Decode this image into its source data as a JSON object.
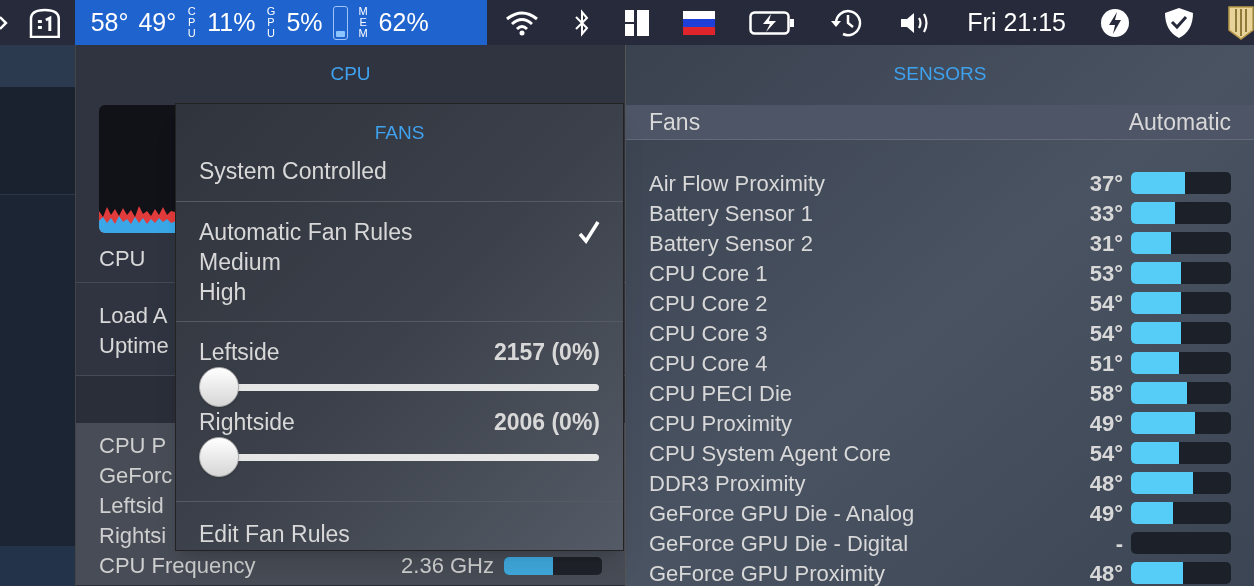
{
  "menu_bar": {
    "stats": [
      {
        "kind": "text",
        "text": "58°"
      },
      {
        "kind": "text",
        "text": "49°"
      },
      {
        "kind": "vlabel",
        "text": "CPU"
      },
      {
        "kind": "text",
        "text": "11%"
      },
      {
        "kind": "vlabel",
        "text": "GPU"
      },
      {
        "kind": "text",
        "text": "5%"
      },
      {
        "kind": "meter",
        "level": 0.2
      },
      {
        "kind": "vlabel",
        "text": "MEM"
      },
      {
        "kind": "text",
        "text": "62%"
      }
    ],
    "clock": "Fri 21:15"
  },
  "cpu_panel": {
    "title": "CPU",
    "graph_label": "CPU",
    "info_rows": [
      "Load A",
      "Uptime"
    ],
    "rows": [
      {
        "label": "CPU P"
      },
      {
        "label": "GeForc"
      },
      {
        "label": "Leftsid"
      },
      {
        "label": "Rightsi"
      },
      {
        "label": "CPU Frequency",
        "value": "2.36 GHz",
        "level": 0.5
      }
    ]
  },
  "fans_menu": {
    "title": "FANS",
    "system_item": "System Controlled",
    "modes": [
      {
        "label": "Automatic Fan Rules",
        "selected": true
      },
      {
        "label": "Medium",
        "selected": false
      },
      {
        "label": "High",
        "selected": false
      }
    ],
    "fans": [
      {
        "name": "Leftside",
        "reading": "2157 (0%)",
        "level": 0
      },
      {
        "name": "Rightside",
        "reading": "2006 (0%)",
        "level": 0
      }
    ],
    "footer_item": "Edit Fan Rules"
  },
  "sensors_panel": {
    "title": "SENSORS",
    "fans_row": {
      "label": "Fans",
      "value": "Automatic"
    },
    "sensors": [
      {
        "name": "Air Flow Proximity",
        "value": "37°",
        "level": 0.54
      },
      {
        "name": "Battery Sensor 1",
        "value": "33°",
        "level": 0.44
      },
      {
        "name": "Battery Sensor 2",
        "value": "31°",
        "level": 0.4
      },
      {
        "name": "CPU Core 1",
        "value": "53°",
        "level": 0.5
      },
      {
        "name": "CPU Core 2",
        "value": "54°",
        "level": 0.5
      },
      {
        "name": "CPU Core 3",
        "value": "54°",
        "level": 0.5
      },
      {
        "name": "CPU Core 4",
        "value": "51°",
        "level": 0.48
      },
      {
        "name": "CPU PECI Die",
        "value": "58°",
        "level": 0.56
      },
      {
        "name": "CPU Proximity",
        "value": "49°",
        "level": 0.64
      },
      {
        "name": "CPU System Agent Core",
        "value": "54°",
        "level": 0.48
      },
      {
        "name": "DDR3 Proximity",
        "value": "48°",
        "level": 0.62
      },
      {
        "name": "GeForce GPU Die - Analog",
        "value": "49°",
        "level": 0.42
      },
      {
        "name": "GeForce GPU Die - Digital",
        "value": "-",
        "level": 0
      },
      {
        "name": "GeForce GPU Proximity",
        "value": "48°",
        "level": 0.52
      }
    ]
  }
}
